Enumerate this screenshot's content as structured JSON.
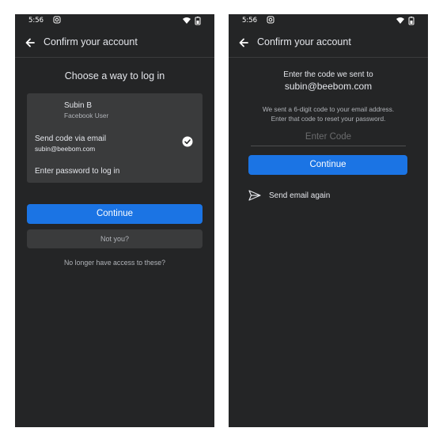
{
  "status": {
    "time": "5:56"
  },
  "left": {
    "title": "Confirm your account",
    "heading": "Choose a way to log in",
    "user": {
      "name": "Subin B",
      "subtitle": "Facebook User"
    },
    "option_email": {
      "label": "Send code via email",
      "address": "subin@beebom.com",
      "selected": true
    },
    "option_password": {
      "label": "Enter password to log in"
    },
    "continue_label": "Continue",
    "not_you_label": "Not you?",
    "no_access_label": "No longer have access to these?"
  },
  "right": {
    "title": "Confirm your account",
    "code_sent_line": "Enter the code we sent to",
    "code_sent_email": "subin@beebom.com",
    "description_line1": "We sent a 6-digit code to your email address.",
    "description_line2": "Enter that code to reset your password.",
    "code_input": {
      "placeholder": "Enter Code",
      "value": ""
    },
    "continue_label": "Continue",
    "send_again_label": "Send email again"
  },
  "icons": {
    "back": "arrow-left-icon",
    "status_app": "instagram-icon",
    "wifi": "wifi-icon",
    "battery": "battery-icon",
    "check": "check-circle-icon",
    "send": "send-icon"
  },
  "colors": {
    "background": "#242526",
    "surface": "#3a3b3c",
    "primary": "#1b74e4",
    "text": "#e4e6eb",
    "muted": "#b0b3b8"
  }
}
